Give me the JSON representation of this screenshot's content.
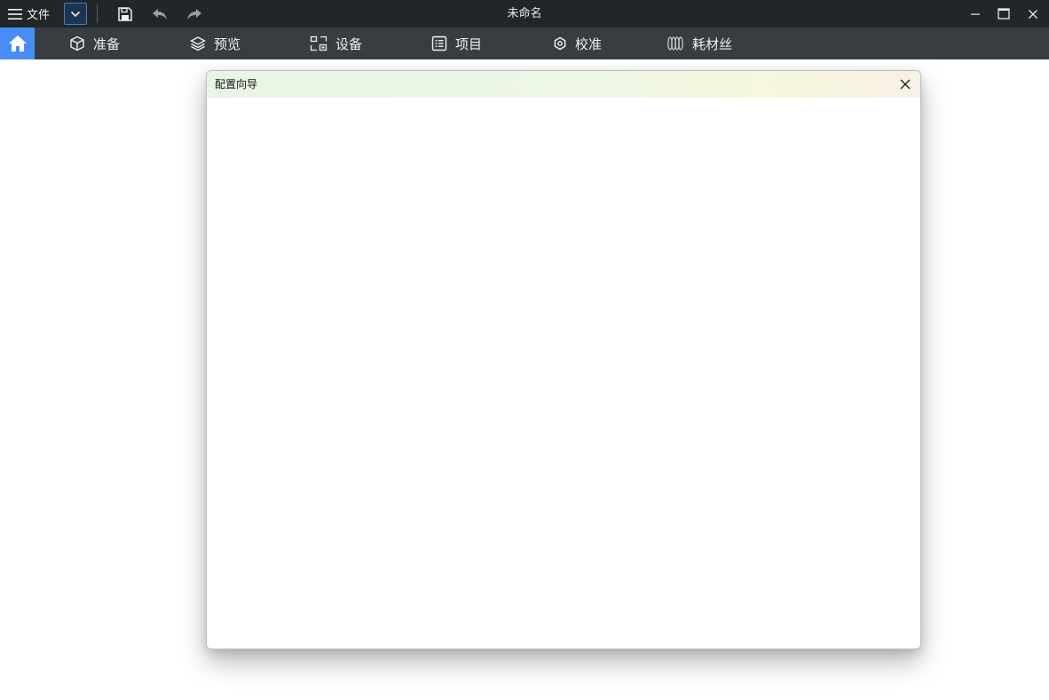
{
  "titlebar": {
    "file_label": "文件",
    "window_title": "未命名"
  },
  "navbar": {
    "items": [
      {
        "label": "准备",
        "icon": "cube-icon"
      },
      {
        "label": "预览",
        "icon": "layers-icon"
      },
      {
        "label": "设备",
        "icon": "device-icon"
      },
      {
        "label": "项目",
        "icon": "project-list-icon"
      },
      {
        "label": "校准",
        "icon": "calibration-icon"
      },
      {
        "label": "耗材丝",
        "icon": "filament-icon"
      }
    ]
  },
  "dialog": {
    "title": "配置向导"
  },
  "colors": {
    "titlebar_bg": "#232629",
    "navbar_bg": "#393d41",
    "home_accent": "#4a8cf6"
  }
}
